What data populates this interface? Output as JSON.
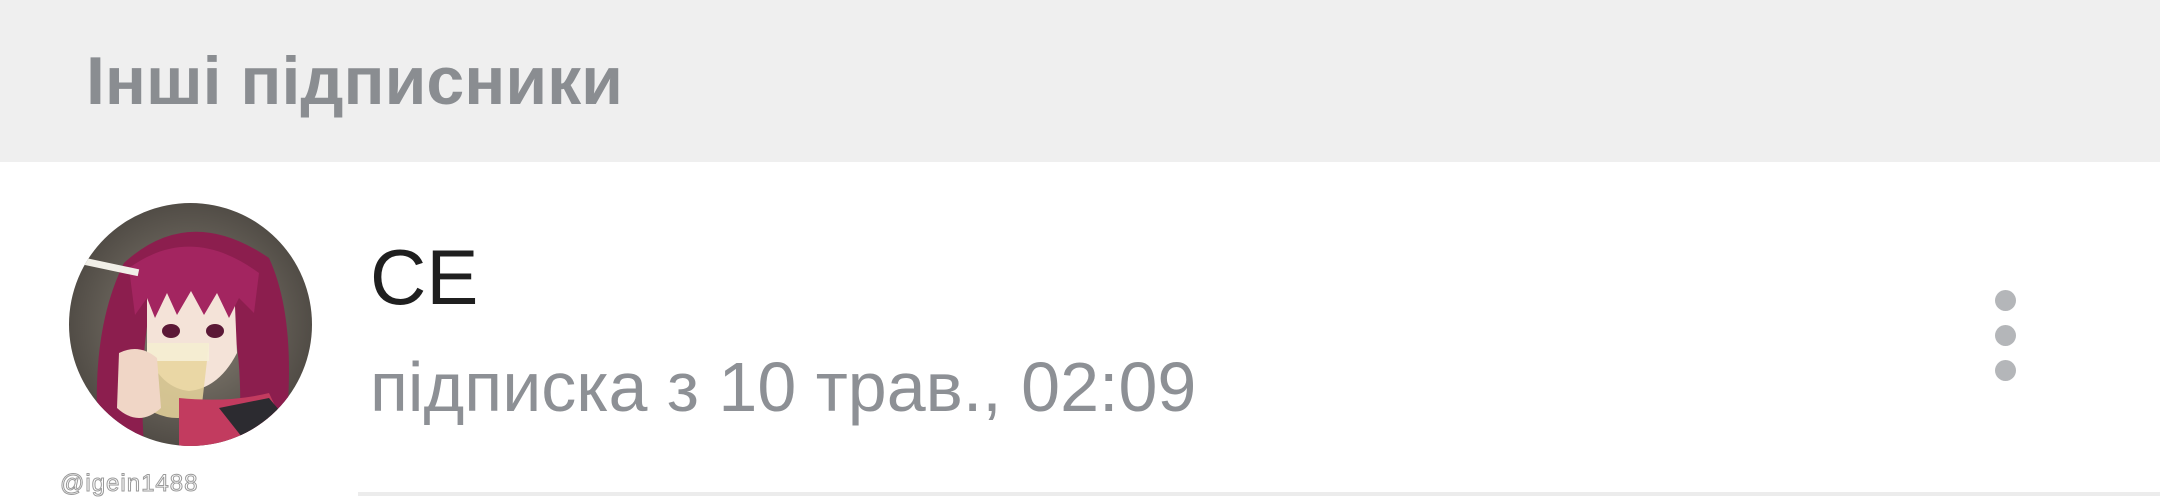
{
  "section": {
    "title": "Інші підписники"
  },
  "subscriber": {
    "name": "CE",
    "subscribed_text": "підписка з 10 трав., 02:09",
    "avatar_icon": "anime-girl-avatar",
    "menu_icon": "more-vertical-icon"
  },
  "watermark": {
    "text": "@igein1488"
  },
  "colors": {
    "header_bg": "#efefef",
    "header_text": "#8a8d91",
    "name_text": "#1f1f1f",
    "sub_text": "#8d9095",
    "menu_dots": "#b4b6b9"
  }
}
